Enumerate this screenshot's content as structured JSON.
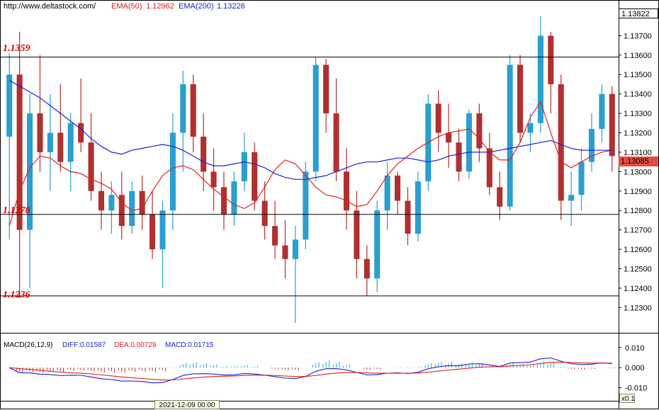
{
  "header": {
    "site": "http://www.deltastock.com/",
    "ema50_label": "EMA(50)",
    "ema50_value": "1.12962",
    "ema200_label": "EMA(200)",
    "ema200_value": "1.13226"
  },
  "levels": [
    "1.1359",
    "1.1278",
    "1.1236"
  ],
  "price_box": "1.13085",
  "top_price_box": "1.13822",
  "macd_header": {
    "name": "MACD(26,12,9)",
    "diff": "DIFF:0.01587",
    "dea": "DEA:0.00729",
    "macd": "MACD:0.01715"
  },
  "macd_scale_box": "x0.1",
  "time_label": "2021-12-09 00:00",
  "colors": {
    "bull": "#2a9fd0",
    "bear": "#b03030",
    "ema50": "#e02020",
    "ema200": "#2020d0",
    "level": "#000000",
    "level_text": "#e00000",
    "price_box": "#e84a40",
    "time_box": "#ffffe0"
  },
  "chart_data": [
    {
      "type": "candlestick",
      "title": "",
      "y_ticks": [
        "1.12300",
        "1.12400",
        "1.12500",
        "1.12600",
        "1.12700",
        "1.12800",
        "1.12900",
        "1.13000",
        "1.13100",
        "1.13200",
        "1.13300",
        "1.13400",
        "1.13500",
        "1.13600",
        "1.13700"
      ],
      "ylim": [
        1.1217,
        1.1384
      ],
      "horizontal_levels": [
        1.1359,
        1.1278,
        1.1236
      ],
      "last_price": 1.13085,
      "series": [
        {
          "name": "EMA(50)",
          "value": 1.12962,
          "values": [
            1.1272,
            1.129,
            1.1302,
            1.1308,
            1.1307,
            1.1303,
            1.13,
            1.1299,
            1.1296,
            1.1294,
            1.1291,
            1.1284,
            1.128,
            1.1281,
            1.129,
            1.1298,
            1.1302,
            1.1303,
            1.1301,
            1.1296,
            1.1291,
            1.1287,
            1.1283,
            1.1281,
            1.1284,
            1.1292,
            1.1301,
            1.1306,
            1.1304,
            1.1298,
            1.1292,
            1.1288,
            1.1287,
            1.1285,
            1.1282,
            1.1283,
            1.129,
            1.1298,
            1.1304,
            1.1308,
            1.1312,
            1.1315,
            1.1318,
            1.132,
            1.1321,
            1.1322,
            1.1317,
            1.131,
            1.1306,
            1.1306,
            1.1315,
            1.1328,
            1.1336,
            1.132,
            1.1305,
            1.1302,
            1.1305,
            1.1308,
            1.131,
            1.1311
          ]
        },
        {
          "name": "EMA(200)",
          "value": 1.13226,
          "values": [
            1.1347,
            1.1344,
            1.1341,
            1.1338,
            1.1334,
            1.133,
            1.1326,
            1.1322,
            1.1317,
            1.1313,
            1.131,
            1.1309,
            1.1311,
            1.1312,
            1.1313,
            1.1314,
            1.1313,
            1.1311,
            1.1308,
            1.1305,
            1.1303,
            1.1303,
            1.1304,
            1.1305,
            1.1304,
            1.1302,
            1.1299,
            1.1297,
            1.1296,
            1.1296,
            1.1297,
            1.1298,
            1.13,
            1.1302,
            1.1304,
            1.1305,
            1.1305,
            1.1306,
            1.1307,
            1.1307,
            1.1306,
            1.1305,
            1.1306,
            1.1308,
            1.1309,
            1.131,
            1.131,
            1.131,
            1.1311,
            1.1312,
            1.1313,
            1.1314,
            1.1315,
            1.1316,
            1.1314,
            1.1312,
            1.1311,
            1.1311,
            1.1311,
            1.1311
          ]
        }
      ],
      "candles_ohlc": [
        [
          1.1318,
          1.1361,
          1.1265,
          1.135
        ],
        [
          1.135,
          1.1372,
          1.1235,
          1.127
        ],
        [
          1.127,
          1.134,
          1.124,
          1.133
        ],
        [
          1.133,
          1.136,
          1.13,
          1.131
        ],
        [
          1.131,
          1.134,
          1.129,
          1.132
        ],
        [
          1.132,
          1.1345,
          1.13,
          1.1305
        ],
        [
          1.1305,
          1.133,
          1.129,
          1.1325
        ],
        [
          1.1325,
          1.1348,
          1.131,
          1.1315
        ],
        [
          1.1315,
          1.133,
          1.1285,
          1.129
        ],
        [
          1.129,
          1.13,
          1.127,
          1.128
        ],
        [
          1.128,
          1.1295,
          1.1268,
          1.1288
        ],
        [
          1.1288,
          1.13,
          1.1265,
          1.1272
        ],
        [
          1.1272,
          1.1295,
          1.1268,
          1.129
        ],
        [
          1.129,
          1.1298,
          1.127,
          1.1278
        ],
        [
          1.1278,
          1.129,
          1.1255,
          1.126
        ],
        [
          1.126,
          1.1285,
          1.124,
          1.128
        ],
        [
          1.128,
          1.133,
          1.127,
          1.132
        ],
        [
          1.132,
          1.1352,
          1.13,
          1.1345
        ],
        [
          1.1345,
          1.135,
          1.131,
          1.1318
        ],
        [
          1.1318,
          1.133,
          1.129,
          1.13
        ],
        [
          1.13,
          1.1312,
          1.128,
          1.1292
        ],
        [
          1.1292,
          1.13,
          1.127,
          1.1278
        ],
        [
          1.1278,
          1.13,
          1.1272,
          1.1295
        ],
        [
          1.1295,
          1.132,
          1.129,
          1.131
        ],
        [
          1.131,
          1.1315,
          1.128,
          1.1285
        ],
        [
          1.1285,
          1.1295,
          1.1265,
          1.1272
        ],
        [
          1.1272,
          1.1285,
          1.1255,
          1.1262
        ],
        [
          1.1262,
          1.1275,
          1.1245,
          1.1255
        ],
        [
          1.1255,
          1.1272,
          1.1222,
          1.1265
        ],
        [
          1.1265,
          1.1305,
          1.126,
          1.13
        ],
        [
          1.13,
          1.1359,
          1.1295,
          1.1355
        ],
        [
          1.1355,
          1.1358,
          1.132,
          1.133
        ],
        [
          1.133,
          1.1348,
          1.1295,
          1.13
        ],
        [
          1.13,
          1.1312,
          1.127,
          1.128
        ],
        [
          1.128,
          1.129,
          1.1245,
          1.1255
        ],
        [
          1.1255,
          1.1262,
          1.1236,
          1.1245
        ],
        [
          1.1245,
          1.1285,
          1.1238,
          1.128
        ],
        [
          1.128,
          1.1305,
          1.127,
          1.1298
        ],
        [
          1.1298,
          1.13,
          1.1278,
          1.1285
        ],
        [
          1.1285,
          1.1292,
          1.1262,
          1.1268
        ],
        [
          1.1268,
          1.13,
          1.1264,
          1.1295
        ],
        [
          1.1295,
          1.134,
          1.129,
          1.1335
        ],
        [
          1.1335,
          1.1342,
          1.131,
          1.132
        ],
        [
          1.132,
          1.1335,
          1.1302,
          1.1315
        ],
        [
          1.1315,
          1.1322,
          1.1295,
          1.13
        ],
        [
          1.13,
          1.1332,
          1.1296,
          1.133
        ],
        [
          1.133,
          1.1335,
          1.1305,
          1.1312
        ],
        [
          1.1312,
          1.132,
          1.1288,
          1.1292
        ],
        [
          1.1292,
          1.13,
          1.1275,
          1.1282
        ],
        [
          1.1282,
          1.136,
          1.128,
          1.1355
        ],
        [
          1.1355,
          1.136,
          1.1315,
          1.132
        ],
        [
          1.132,
          1.133,
          1.131,
          1.1325
        ],
        [
          1.1325,
          1.138,
          1.132,
          1.137
        ],
        [
          1.137,
          1.1372,
          1.133,
          1.1345
        ],
        [
          1.1345,
          1.135,
          1.1275,
          1.1285
        ],
        [
          1.1285,
          1.13,
          1.1272,
          1.1288
        ],
        [
          1.1288,
          1.1312,
          1.128,
          1.1305
        ],
        [
          1.1305,
          1.133,
          1.13,
          1.1322
        ],
        [
          1.1322,
          1.1345,
          1.1315,
          1.134
        ],
        [
          1.134,
          1.1344,
          1.13,
          1.1308
        ]
      ]
    },
    {
      "type": "bar+line",
      "title": "MACD(26,12,9)",
      "y_ticks": [
        "0.010",
        "0.000",
        "-0.010"
      ],
      "ylim": [
        -0.0165,
        0.0145
      ],
      "series": [
        {
          "name": "DIFF",
          "value": 0.01587
        },
        {
          "name": "DEA",
          "value": 0.00729
        },
        {
          "name": "MACD",
          "value": 0.01715
        }
      ]
    }
  ]
}
